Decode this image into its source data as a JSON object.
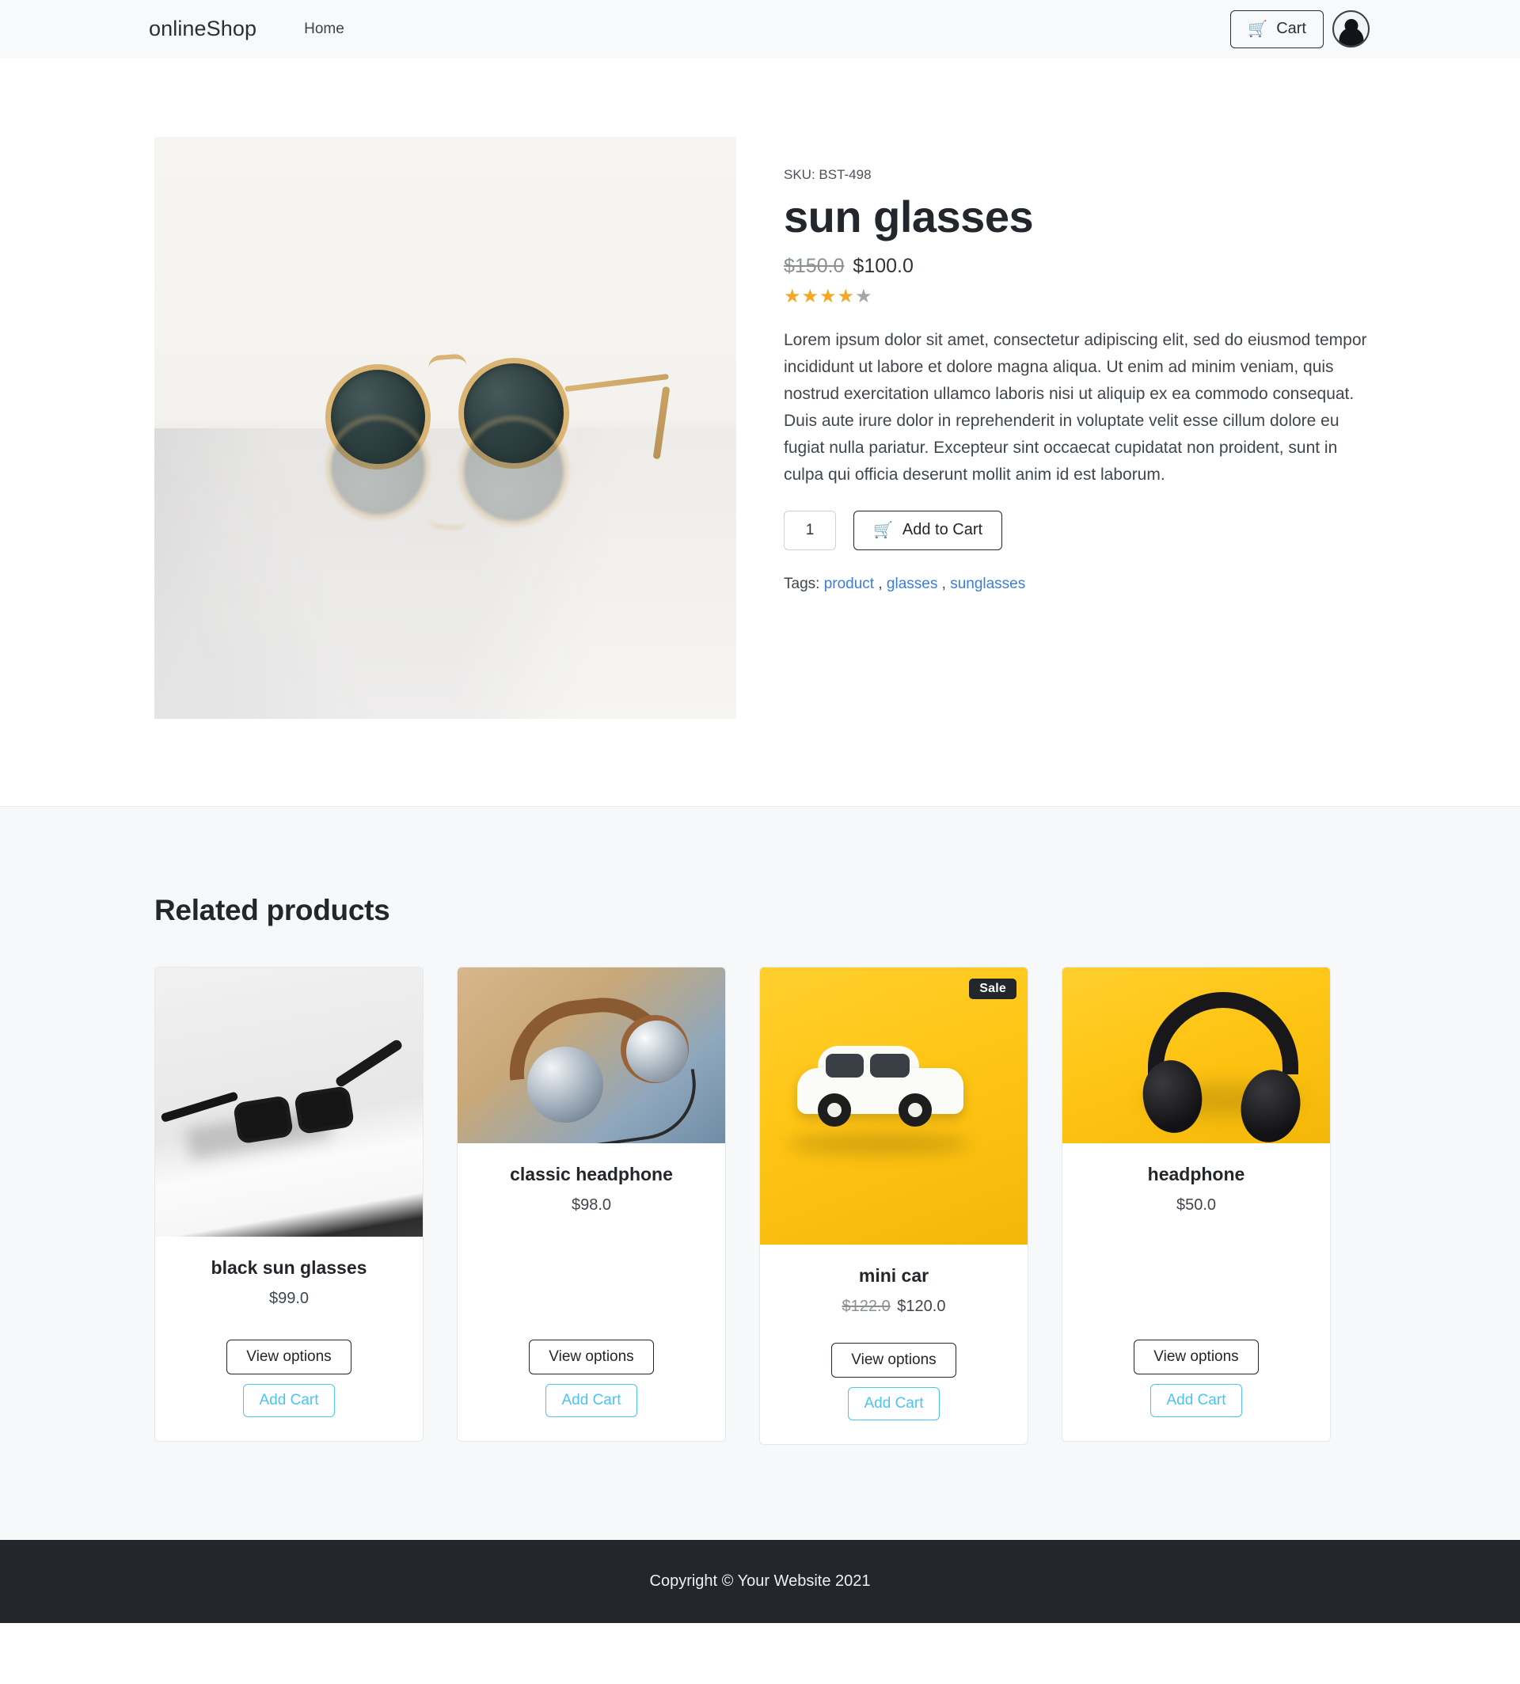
{
  "navbar": {
    "brand": "onlineShop",
    "home_label": "Home",
    "cart_label": "Cart",
    "cart_icon": "shopping-cart-icon",
    "avatar_icon": "user-avatar-icon"
  },
  "product": {
    "sku": "SKU: BST-498",
    "title": "sun glasses",
    "old_price": "$150.0",
    "price": "$100.0",
    "rating_filled": 4,
    "rating_total": 5,
    "description": "Lorem ipsum dolor sit amet, consectetur adipiscing elit, sed do eiusmod tempor incididunt ut labore et dolore magna aliqua. Ut enim ad minim veniam, quis nostrud exercitation ullamco laboris nisi ut aliquip ex ea commodo consequat. Duis aute irure dolor in reprehenderit in voluptate velit esse cillum dolore eu fugiat nulla pariatur. Excepteur sint occaecat cupidatat non proident, sunt in culpa qui officia deserunt mollit anim id est laborum.",
    "quantity": "1",
    "add_to_cart_label": "Add to Cart",
    "tags_label": "Tags:",
    "tags": [
      "product",
      "glasses",
      "sunglasses"
    ],
    "image_alt": "gold round sunglasses on white marble"
  },
  "related": {
    "heading": "Related products",
    "view_options_label": "View options",
    "add_cart_label": "Add Cart",
    "sale_badge_label": "Sale",
    "products": [
      {
        "name": "black sun glasses",
        "price": "$99.0",
        "old_price": "",
        "sale": false,
        "image_alt": "black wayfarer sunglasses black and white photo"
      },
      {
        "name": "classic headphone",
        "price": "$98.0",
        "old_price": "",
        "sale": false,
        "image_alt": "chrome and brown vintage headphones"
      },
      {
        "name": "mini car",
        "price": "$120.0",
        "old_price": "$122.0",
        "sale": true,
        "image_alt": "white toy car on yellow background"
      },
      {
        "name": "headphone",
        "price": "$50.0",
        "old_price": "",
        "sale": false,
        "image_alt": "black over-ear headphones on yellow background"
      }
    ]
  },
  "footer": {
    "copyright": "Copyright © Your Website 2021"
  },
  "colors": {
    "accent_link": "#3b7ddd",
    "add_cart_outline": "#4dc3f0",
    "dark": "#23272b",
    "star_on": "#f5a623",
    "star_off": "#a6a6a6",
    "navbar_bg": "#f7f9fa",
    "related_bg": "#f6f8f9"
  }
}
